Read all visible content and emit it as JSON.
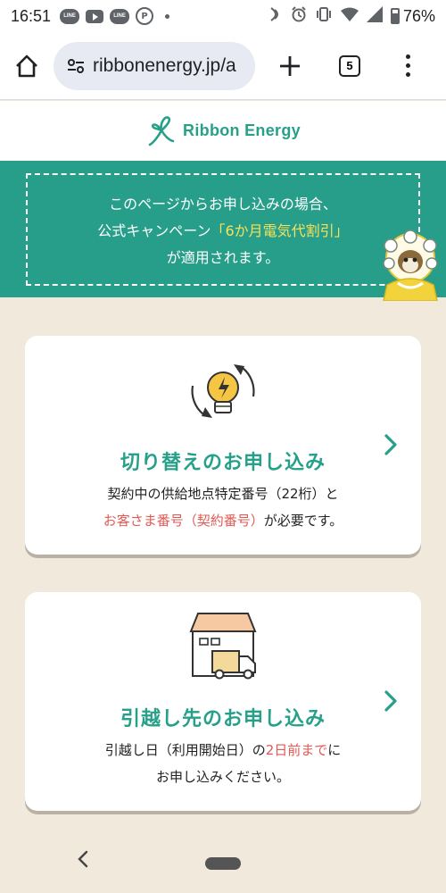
{
  "status_bar": {
    "time": "16:51",
    "app_icons": [
      "line-icon",
      "youtube-icon",
      "line-icon",
      "parking-icon"
    ],
    "battery": "76%"
  },
  "browser": {
    "url": "ribbonenergy.jp/a",
    "tab_count": "5"
  },
  "header": {
    "logo_text": "Ribbon Energy",
    "brand_color": "#27a08a"
  },
  "banner": {
    "line1": "このページからお申し込みの場合、",
    "line2_before": "公式キャンペーン",
    "line2_highlight": "「6か月電気代割引」",
    "line3": "が適用されます。",
    "bg_color": "#279e89",
    "highlight_color": "#f5e25b"
  },
  "cards": [
    {
      "icon": "lightbulb-switch-icon",
      "title": "切り替えのお申し込み",
      "desc_line1": "契約中の供給地点特定番号（22桁）と",
      "desc_line2_red": "お客さま番号（契約番号）",
      "desc_line2_rest": "が必要です。"
    },
    {
      "icon": "moving-truck-house-icon",
      "title": "引越し先のお申し込み",
      "desc_line1_before": "引越し日（利用開始日）の",
      "desc_line1_red": "2日前まで",
      "desc_line1_after": "に",
      "desc_line2": "お申し込みください。"
    }
  ]
}
